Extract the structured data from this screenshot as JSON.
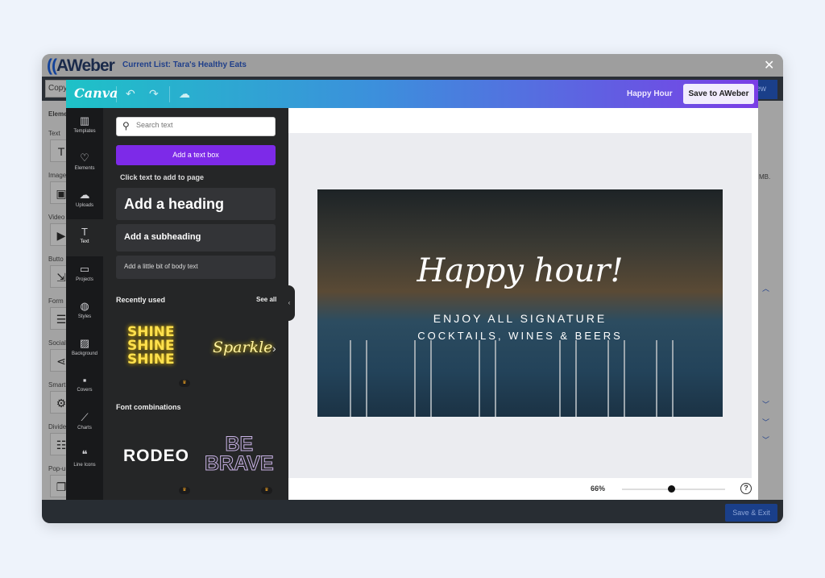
{
  "aweber": {
    "logo": "AWeber",
    "current_list": "Current List: Tara's Healthy Eats",
    "copy_field": "Copy",
    "preview_label": "iew",
    "size_note": "MB.",
    "save_exit": "Save & Exit",
    "sidebar": [
      {
        "label": "Eleme"
      },
      {
        "label": "Text",
        "icon": "T"
      },
      {
        "label": "Image",
        "icon": "▣"
      },
      {
        "label": "Video",
        "icon": "▶"
      },
      {
        "label": "Butto",
        "icon": "⇲"
      },
      {
        "label": "Form",
        "icon": "☰"
      },
      {
        "label": "Social",
        "icon": "⋖"
      },
      {
        "label": "Smart",
        "icon": "⚙"
      },
      {
        "label": "Divide",
        "icon": "☷"
      },
      {
        "label": "Pop-u",
        "icon": "❐"
      }
    ]
  },
  "canva": {
    "logo": "Canva",
    "design_title": "Happy Hour",
    "save_button": "Save to AWeber",
    "rail": [
      {
        "label": "Templates",
        "icon": "▥"
      },
      {
        "label": "Elements",
        "icon": "♡"
      },
      {
        "label": "Uploads",
        "icon": "☁"
      },
      {
        "label": "Text",
        "icon": "T",
        "active": true
      },
      {
        "label": "Projects",
        "icon": "▭"
      },
      {
        "label": "Styles",
        "icon": "◍"
      },
      {
        "label": "Background",
        "icon": "▨"
      },
      {
        "label": "Covers",
        "icon": "▪"
      },
      {
        "label": "Charts",
        "icon": "⟋"
      },
      {
        "label": "Line Icons",
        "icon": "❝"
      }
    ],
    "search_placeholder": "Search text",
    "add_text_box": "Add a text box",
    "click_hint": "Click text to add to page",
    "add_heading": "Add a heading",
    "add_subheading": "Add a subheading",
    "add_body": "Add a little bit of body text",
    "recently_used": "Recently used",
    "see_all": "See all",
    "recent_items": [
      "SHINE SHINE SHINE",
      "Sparkle"
    ],
    "font_combinations": "Font combinations",
    "font_items": [
      "RODEO",
      "BE BRAVE"
    ],
    "zoom_level": "66%",
    "zoom_percent": 66,
    "design": {
      "title": "Happy hour!",
      "line1": "ENJOY ALL SIGNATURE",
      "line2": "COCKTAILS, WINES & BEERS"
    }
  },
  "colors": {
    "canva_purple": "#7d2ae8",
    "aweber_blue": "#1a3f8a",
    "gradient_start": "#1ec2c7",
    "gradient_end": "#7a3ee6"
  }
}
